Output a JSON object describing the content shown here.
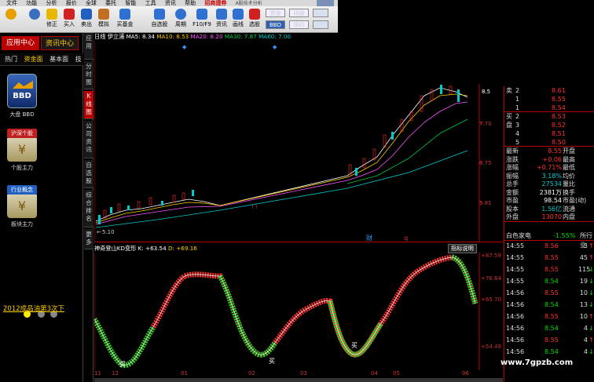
{
  "menubar": {
    "items": [
      "文件",
      "功能",
      "分析",
      "报价",
      "全球",
      "委托",
      "智能",
      "工具",
      "资讯",
      "帮助"
    ],
    "brand": "招商證券",
    "sub": "A股技术分析"
  },
  "toolbar": {
    "buttons": [
      {
        "label": "",
        "icon": "logo-icon",
        "color": "#e8a000"
      },
      {
        "label": "",
        "icon": "back-icon",
        "color": "#3a6fc0"
      },
      {
        "label": "修正",
        "icon": "up-icon",
        "color": "#e8b800"
      },
      {
        "label": "买入",
        "icon": "buy-icon",
        "color": "#d02020"
      },
      {
        "label": "卖出",
        "icon": "sell-icon",
        "color": "#2060c0"
      },
      {
        "label": "模拟",
        "icon": "hammer-icon",
        "color": "#c07020"
      },
      {
        "label": "买基金",
        "icon": "fund-icon",
        "color": "#3070d0"
      },
      {
        "label": "自选股",
        "icon": "star-icon",
        "color": "#3070d0"
      },
      {
        "label": "周期",
        "icon": "clock-icon",
        "color": "#3070d0"
      },
      {
        "label": "F10/F9",
        "icon": "doc-icon",
        "color": "#3070d0"
      },
      {
        "label": "资讯",
        "icon": "news-icon",
        "color": "#3070d0"
      },
      {
        "label": "画线",
        "icon": "pen-icon",
        "color": "#3070d0"
      },
      {
        "label": "选股",
        "icon": "select-icon",
        "color": "#d02020"
      }
    ],
    "zijin": "资金",
    "yanbao": "研报",
    "bbd": "BBD",
    "zeshi": "择时"
  },
  "left": {
    "tab_active": "应用中心",
    "tab_other": "资讯中心",
    "subtabs": [
      "热门",
      "资金面",
      "基本面",
      "技"
    ],
    "apps": [
      {
        "title": "BBD",
        "label": "大盘 BBD"
      },
      {
        "title": "沪深个股",
        "label": "个股主力"
      },
      {
        "title": "行业概念",
        "label": "板块主力"
      }
    ],
    "link": "2012成品油第3次下"
  },
  "side": {
    "tabs": [
      "应用",
      "分时图",
      "K线图",
      "公司资讯",
      "自选股",
      "综合排名",
      "更多"
    ],
    "active": "K线图"
  },
  "kline": {
    "stock": "日线",
    "name": "伊立浦",
    "ma5": "MA5: 8.34",
    "ma10": "MA10: 8.53",
    "ma20": "MA20: 8.20",
    "ma30": "MA30: 7.87",
    "ma60": "MA60: 7.00",
    "prices": [
      "8.5",
      "7.70",
      "6.75",
      "5.81"
    ],
    "low": "5.10",
    "cai": "财",
    "q": "q"
  },
  "indicator": {
    "title": "神奇登山KD变形",
    "k": "K: +63.54",
    "d": "D: +69.16",
    "help": "指标说明",
    "levels": [
      "+87.59",
      "+76.64",
      "+65.70",
      "+54.49"
    ],
    "marks": [
      "买",
      "买",
      "买"
    ]
  },
  "xaxis": [
    "11",
    "12",
    "01",
    "02",
    "03",
    "04",
    "05",
    "06"
  ],
  "orderbook": [
    {
      "side": "卖",
      "n": "2",
      "p": "8.61",
      "v": ""
    },
    {
      "side": "",
      "n": "1",
      "p": "8.55",
      "v": ""
    },
    {
      "side": "",
      "n": "1",
      "p": "8.54",
      "v": ""
    },
    {
      "side": "买",
      "n": "2",
      "p": "8.53",
      "v": ""
    },
    {
      "side": "盘",
      "n": "3",
      "p": "8.52",
      "v": ""
    },
    {
      "side": "",
      "n": "4",
      "p": "8.51",
      "v": ""
    },
    {
      "side": "",
      "n": "5",
      "p": "8.50",
      "v": ""
    }
  ],
  "stats": [
    {
      "k": "最新",
      "v": "8.55",
      "k2": "开盘",
      "c": "red"
    },
    {
      "k": "涨跌",
      "v": "+0.06",
      "k2": "最高",
      "c": "red"
    },
    {
      "k": "涨幅",
      "v": "+0.71%",
      "k2": "最低",
      "c": "red"
    },
    {
      "k": "振幅",
      "v": "3.18%",
      "k2": "均价",
      "c": "cyan"
    },
    {
      "k": "总手",
      "v": "27534",
      "k2": "量比",
      "c": "cyan"
    },
    {
      "k": "金额",
      "v": "2381万",
      "k2": "换手",
      "c": "white"
    },
    {
      "k": "市盈",
      "v": "98.54",
      "k2": "市盈(动)",
      "c": "white"
    },
    {
      "k": "股本",
      "v": "1.56亿",
      "k2": "流通",
      "c": "cyan"
    },
    {
      "k": "外盘",
      "v": "13070",
      "k2": "内盘",
      "c": "red"
    }
  ],
  "ticks_header": {
    "a": "白色家电",
    "b": "-1.55%",
    "c": "所行业"
  },
  "ticks": [
    {
      "t": "14:55",
      "p": "8.56",
      "q": "3",
      "d": "↑",
      "c": "red"
    },
    {
      "t": "14:55",
      "p": "8.55",
      "q": "45",
      "d": "↑",
      "c": "red"
    },
    {
      "t": "14:55",
      "p": "8.55",
      "q": "115",
      "d": "↓",
      "c": "red"
    },
    {
      "t": "14:55",
      "p": "8.54",
      "q": "19",
      "d": "↓",
      "c": "green"
    },
    {
      "t": "14:56",
      "p": "8.55",
      "q": "10",
      "d": "↓",
      "c": "red"
    },
    {
      "t": "14:56",
      "p": "8.54",
      "q": "13",
      "d": "↓",
      "c": "green"
    },
    {
      "t": "14:56",
      "p": "8.55",
      "q": "10",
      "d": "↑",
      "c": "red"
    },
    {
      "t": "14:56",
      "p": "8.54",
      "q": "4",
      "d": "↓",
      "c": "green"
    },
    {
      "t": "14:56",
      "p": "8.55",
      "q": "4",
      "d": "↑",
      "c": "red"
    },
    {
      "t": "14:56",
      "p": "8.54",
      "q": "4",
      "d": "↓",
      "c": "green"
    }
  ],
  "watermark": "www.7gpzb.com"
}
